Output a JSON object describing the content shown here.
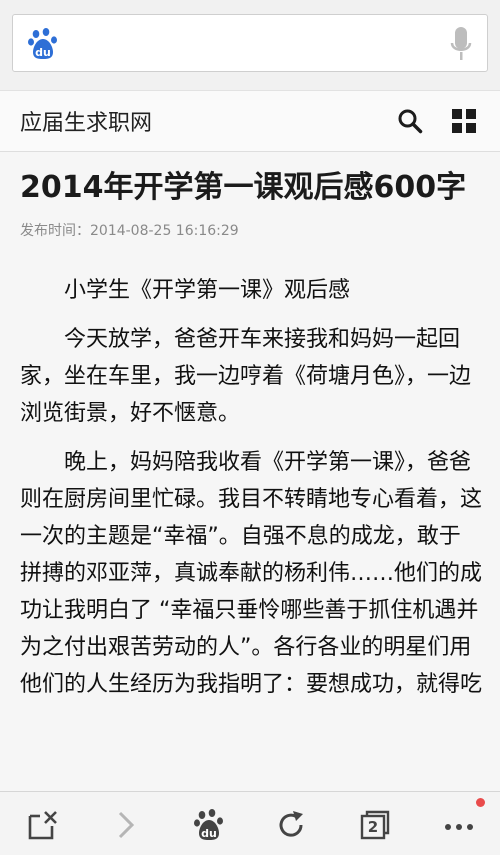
{
  "browser": {
    "search_placeholder": "",
    "site_name": "应届生求职网"
  },
  "article": {
    "title": "2014年开学第一课观后感600字",
    "meta": "发布时间：2014-08-25 16:16:29",
    "paragraphs": [
      "小学生《开学第一课》观后感",
      "今天放学，爸爸开车来接我和妈妈一起回家，坐在车里，我一边哼着《荷塘月色》，一边浏览街景，好不惬意。",
      "晚上，妈妈陪我收看《开学第一课》，爸爸则在厨房间里忙碌。我目不转睛地专心看着，这一次的主题是“幸福”。自强不息的成龙，敢于拼搏的邓亚萍，真诚奉献的杨利伟……他们的成功让我明白了 “幸福只垂怜哪些善于抓住机遇并为之付出艰苦劳动的人”。各行各业的明星们用他们的人生经历为我指明了：要想成功，就得吃"
    ]
  },
  "bottom_bar": {
    "tab_count": "2"
  },
  "colors": {
    "accent_blue": "#2e6fd6",
    "notification_red": "#e94b4b"
  }
}
